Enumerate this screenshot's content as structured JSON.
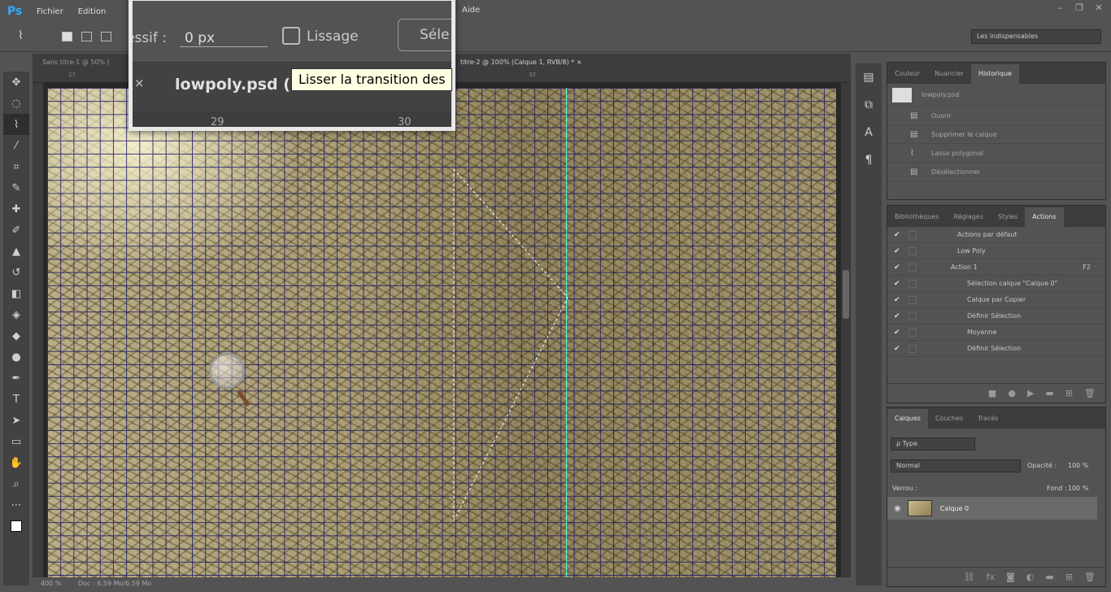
{
  "app": {
    "logo": "Ps",
    "menu": [
      "Fichier",
      "Edition"
    ],
    "menu_last": "Aide",
    "window_controls": [
      "–",
      "❐",
      "✕"
    ]
  },
  "options_bar": {
    "feather_label": "essif :",
    "feather_value": "0 px",
    "antialias_label": "Lissage",
    "select_button": "Séle",
    "workspace": "Les indispensables"
  },
  "doc_tabs": [
    {
      "label": "Sans titre-1 @ 50% (",
      "close": ""
    },
    {
      "label": "titre-2 @ 100% (Calque 1, RVB/8) *",
      "close": "×"
    }
  ],
  "popup": {
    "tab_label": "lowpoly.psd (",
    "close": "×",
    "ruler_ticks": [
      "29",
      "30"
    ]
  },
  "tooltip": "Lisser la transition des",
  "rulers": {
    "top_ticks": [
      "27",
      "32"
    ]
  },
  "status": {
    "zoom": "400 %",
    "doc": "Doc : 6,59 Mo/6,59 Mo"
  },
  "history_panel": {
    "tabs": [
      "Couleur",
      "Nuancier",
      "Historique"
    ],
    "snapshot": "lowpoly.psd",
    "items": [
      "Ouvrir",
      "Supprimer le calque",
      "Lasso polygonal",
      "Désélectionner"
    ]
  },
  "actions_panel": {
    "tabs": [
      "Bibliothèques",
      "Réglages",
      "Styles",
      "Actions"
    ],
    "items": [
      {
        "label": "Actions par défaut",
        "shortcut": ""
      },
      {
        "label": "Low Poly",
        "shortcut": ""
      },
      {
        "label": "Action 1",
        "shortcut": "F2"
      },
      {
        "label": "Sélection calque \"Calque 0\"",
        "shortcut": ""
      },
      {
        "label": "Calque par Copier",
        "shortcut": ""
      },
      {
        "label": "Définir Sélection",
        "shortcut": ""
      },
      {
        "label": "Moyenne",
        "shortcut": ""
      },
      {
        "label": "Définir Sélection",
        "shortcut": ""
      }
    ]
  },
  "layers_panel": {
    "tabs": [
      "Calques",
      "Couches",
      "Tracés"
    ],
    "filter": "ρ Type",
    "blend_mode": "Normal",
    "opacity_label": "Opacité :",
    "opacity_value": "100 %",
    "lock_label": "Verrou :",
    "fill_label": "Fond :",
    "fill_value": "100 %",
    "layer_name": "Calque 0"
  }
}
